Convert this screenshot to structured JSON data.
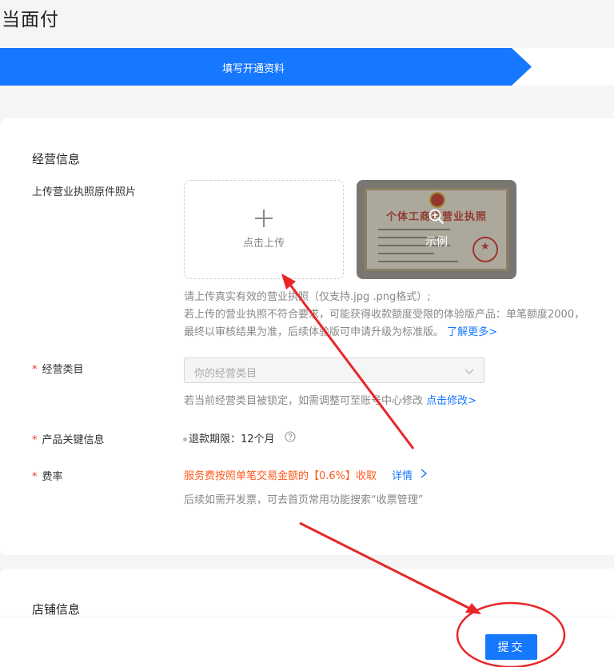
{
  "page": {
    "title": "当面付"
  },
  "steps": {
    "active_label": "填写开通资料"
  },
  "business_info": {
    "section_title": "经营信息",
    "license_label": "上传营业执照原件照片",
    "upload_text": "点击上传",
    "sample_cert_title": "个体工商户营业执照",
    "sample_text": "示例",
    "hint_line1": "请上传真实有效的营业执照（仅支持.jpg .png格式）;",
    "hint_line2": "若上传的营业执照不符合要求，可能获得收款额度受限的体验版产品：单笔额度2000，",
    "hint_line3": "最终以审核结果为准，后续体验版可申请升级为标准版。",
    "learn_more": "了解更多>",
    "category_label": "经营类目",
    "category_placeholder": "你的经营类目",
    "category_hint": "若当前经营类目被锁定，如需调整可至账号中心修改",
    "category_link": "点击修改>",
    "product_label": "产品关键信息",
    "refund_text": "退款期限：12个月",
    "fee_label": "费率",
    "fee_text": "服务费按照单笔交易金额的【0.6%】收取",
    "fee_detail": "详情",
    "fee_hint": "后续如需开发票，可去首页常用功能搜索“收票管理”"
  },
  "shop_info": {
    "section_title": "店铺信息"
  },
  "footer": {
    "submit_label": "提交"
  },
  "colors": {
    "primary": "#1677ff",
    "fee": "#ff5b1f",
    "required": "#e4393c",
    "annotation": "#e8262a"
  },
  "icons": [
    "plus-icon",
    "zoom-in-icon",
    "chevron-down-icon",
    "question-circle-icon",
    "chevron-right-icon"
  ]
}
